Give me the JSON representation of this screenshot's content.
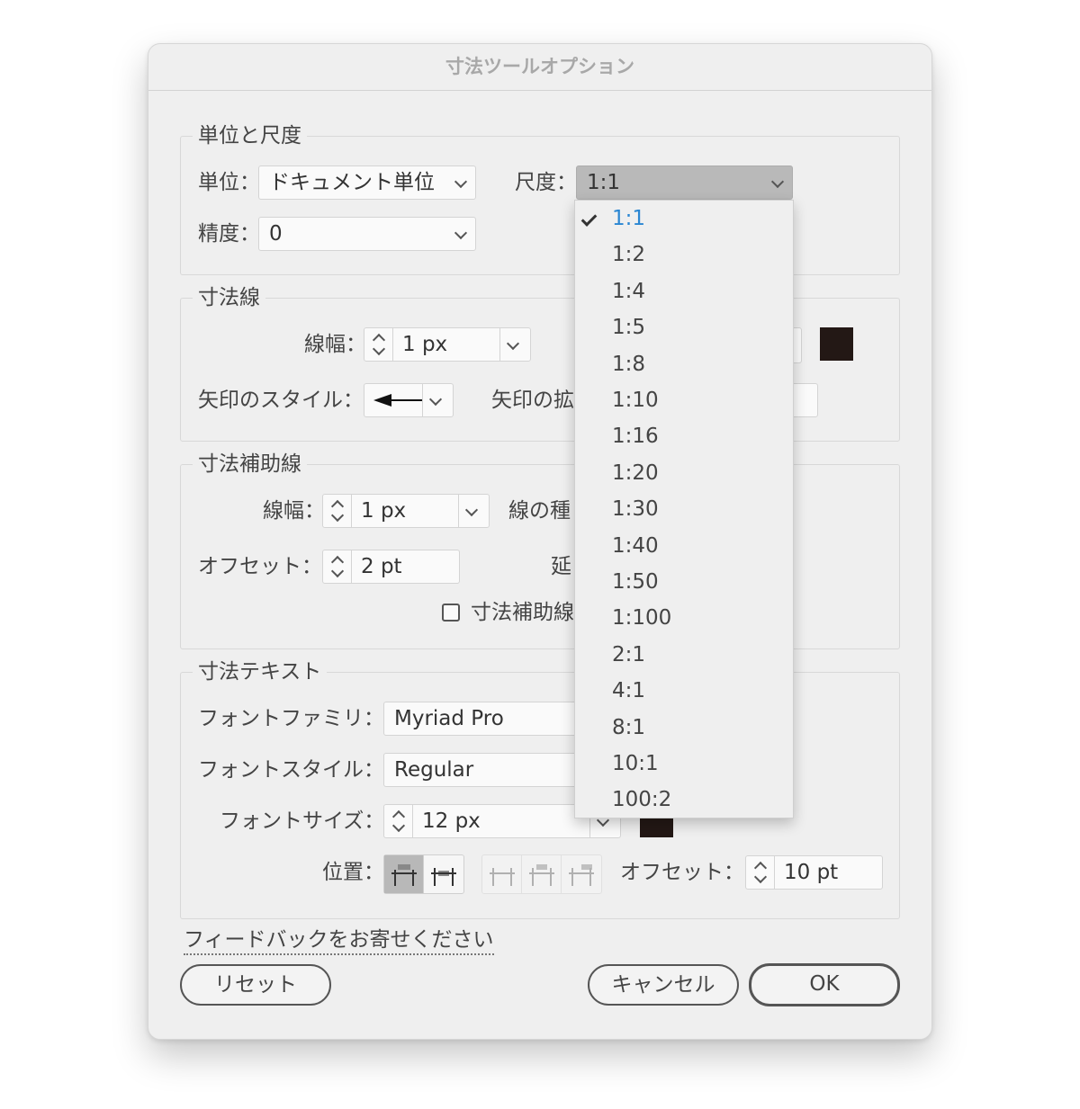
{
  "window": {
    "title": "寸法ツールオプション"
  },
  "units_group": {
    "title": "単位と尺度",
    "unit_label": "単位：",
    "unit_value": "ドキュメント単位",
    "scale_label": "尺度：",
    "scale_value": "1:1",
    "precision_label": "精度：",
    "precision_value": "0"
  },
  "dimension_line": {
    "title": "寸法線",
    "width_label": "線幅：",
    "width_value": "1 px",
    "arrow_style_label": "矢印のスタイル：",
    "arrow_scale_label": "矢印の拡",
    "color": "#231815"
  },
  "extension_line": {
    "title": "寸法補助線",
    "width_label": "線幅：",
    "width_value": "1 px",
    "line_type_label": "線の種",
    "offset_label": "オフセット：",
    "offset_value": "2 pt",
    "extend_label": "延",
    "checkbox_label": "寸法補助線"
  },
  "dimension_text": {
    "title": "寸法テキスト",
    "font_family_label": "フォントファミリ：",
    "font_family_value": "Myriad Pro",
    "font_style_label": "フォントスタイル：",
    "font_style_value": "Regular",
    "font_size_label": "フォントサイズ：",
    "font_size_value": "12 px",
    "position_label": "位置：",
    "offset_label": "オフセット：",
    "offset_value": "10 pt",
    "color": "#231815"
  },
  "footer": {
    "feedback_link": "フィードバックをお寄せください",
    "reset_button": "リセット",
    "cancel_button": "キャンセル",
    "ok_button": "OK"
  },
  "scale_menu": {
    "selected": "1:1",
    "options": [
      "1:1",
      "1:2",
      "1:4",
      "1:5",
      "1:8",
      "1:10",
      "1:16",
      "1:20",
      "1:30",
      "1:40",
      "1:50",
      "1:100",
      "2:1",
      "4:1",
      "8:1",
      "10:1",
      "100:2"
    ]
  },
  "colors": {
    "accent": "#2a86d2",
    "swatch": "#231815",
    "dialog_bg": "#efefef"
  }
}
